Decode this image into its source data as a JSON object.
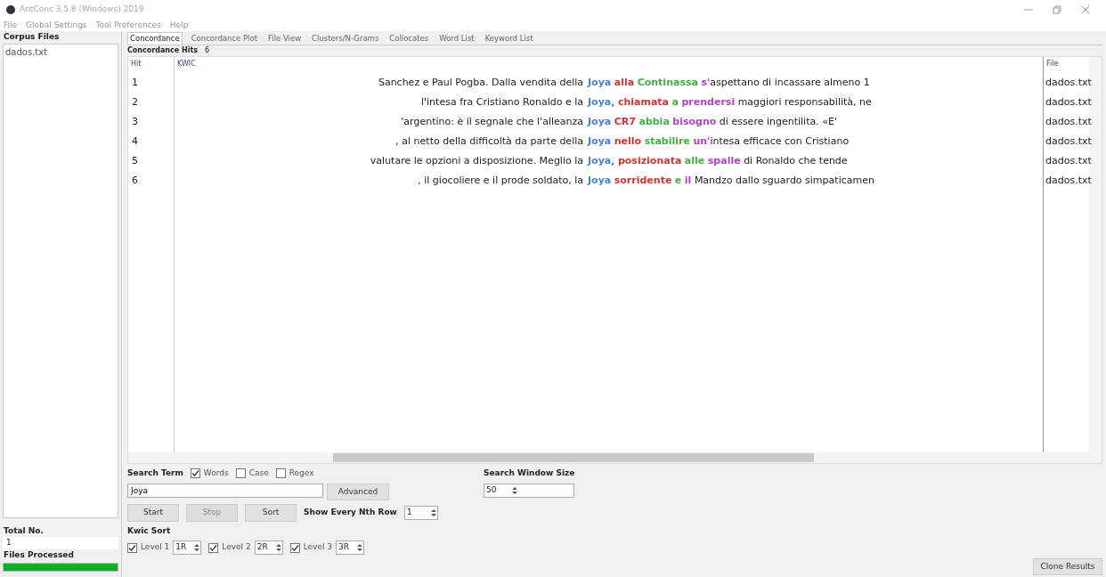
{
  "window": {
    "title": "AntConc 3.5.8 (Windows) 2019"
  },
  "menu": [
    "File",
    "Global Settings",
    "Tool Preferences",
    "Help"
  ],
  "sidebar": {
    "title": "Corpus Files",
    "files": [
      "dados.txt"
    ],
    "total_label": "Total No.",
    "total": "1",
    "processed_label": "Files Processed",
    "level": 1
  },
  "tabs": [
    {
      "label": "Concordance",
      "selected": true
    },
    {
      "label": "Concordance Plot",
      "selected": false
    },
    {
      "label": "File View",
      "selected": false
    },
    {
      "label": "Clusters/N-Grams",
      "selected": false
    },
    {
      "label": "Collocates",
      "selected": false
    },
    {
      "label": "Word List",
      "selected": false
    },
    {
      "label": "Keyword List",
      "selected": false
    }
  ],
  "hits": {
    "label": "Concordance Hits",
    "count": "6"
  },
  "table": {
    "columns": [
      "Hit",
      "KWIC",
      "File"
    ],
    "rows": [
      {
        "hit": "1",
        "left": "Sanchez e Paul Pogba. Dalla vendita della",
        "tokens": [
          {
            "text": "Joya",
            "color": "#4a7fd4"
          },
          {
            "text": "alla",
            "color": "#d03434"
          },
          {
            "text": "Continassa",
            "color": "#44b044"
          },
          {
            "text": "s'",
            "color": "#b044c0",
            "attached": true
          }
        ],
        "right": "aspettano di incassare almeno 1",
        "file": "dados.txt"
      },
      {
        "hit": "2",
        "left": "l'intesa fra Cristiano Ronaldo e la",
        "tokens": [
          {
            "text": "Joya,",
            "color": "#4a7fd4"
          },
          {
            "text": "chiamata",
            "color": "#d03434"
          },
          {
            "text": "a",
            "color": "#44b044"
          },
          {
            "text": "prendersi",
            "color": "#b044c0"
          }
        ],
        "right": "maggiori responsabilità, ne",
        "file": "dados.txt"
      },
      {
        "hit": "3",
        "left": "'argentino: è il segnale che l'alleanza",
        "tokens": [
          {
            "text": "Joya",
            "color": "#4a7fd4"
          },
          {
            "text": "CR7",
            "color": "#d03434"
          },
          {
            "text": "abbia",
            "color": "#44b044"
          },
          {
            "text": "bisogno",
            "color": "#b044c0"
          }
        ],
        "right": "di essere ingentilita. «E'",
        "file": "dados.txt"
      },
      {
        "hit": "4",
        "left": ", al netto della difficoltà da parte della",
        "tokens": [
          {
            "text": "Joya",
            "color": "#4a7fd4"
          },
          {
            "text": "nello",
            "color": "#d03434"
          },
          {
            "text": "stabilire",
            "color": "#44b044"
          },
          {
            "text": "un'",
            "color": "#b044c0",
            "attached": true
          }
        ],
        "right": "intesa efficace con Cristiano",
        "file": "dados.txt"
      },
      {
        "hit": "5",
        "left": "valutare le opzioni a disposizione. Meglio la",
        "tokens": [
          {
            "text": "Joya,",
            "color": "#4a7fd4"
          },
          {
            "text": "posizionata",
            "color": "#d03434"
          },
          {
            "text": "alle",
            "color": "#44b044"
          },
          {
            "text": "spalle",
            "color": "#b044c0"
          }
        ],
        "right": "di Ronaldo che tende",
        "file": "dados.txt"
      },
      {
        "hit": "6",
        "left": ", il giocoliere e il prode soldato, la",
        "tokens": [
          {
            "text": "Joya",
            "color": "#4a7fd4"
          },
          {
            "text": "sorridente",
            "color": "#d03434"
          },
          {
            "text": "e",
            "color": "#44b044"
          },
          {
            "text": "il",
            "color": "#b044c0"
          }
        ],
        "right": "Mandzo dallo sguardo simpaticamen",
        "file": "dados.txt"
      }
    ]
  },
  "search": {
    "label": "Search Term",
    "options": [
      {
        "label": "Words",
        "checked": true
      },
      {
        "label": "Case",
        "checked": false
      },
      {
        "label": "Regex",
        "checked": false
      }
    ],
    "value": "Joya",
    "advanced": "Advanced",
    "buttons": [
      {
        "label": "Start",
        "disabled": false
      },
      {
        "label": "Stop",
        "disabled": true
      },
      {
        "label": "Sort",
        "disabled": false
      }
    ],
    "nth_label": "Show Every Nth Row",
    "nth": "1",
    "window_label": "Search Window Size",
    "window_size": "50"
  },
  "kwic_sort": {
    "label": "Kwic Sort",
    "levels": [
      {
        "label": "Level 1",
        "value": "1R",
        "checked": true
      },
      {
        "label": "Level 2",
        "value": "2R",
        "checked": true
      },
      {
        "label": "Level 3",
        "value": "3R",
        "checked": true
      }
    ]
  },
  "clone_button": "Clone Results"
}
